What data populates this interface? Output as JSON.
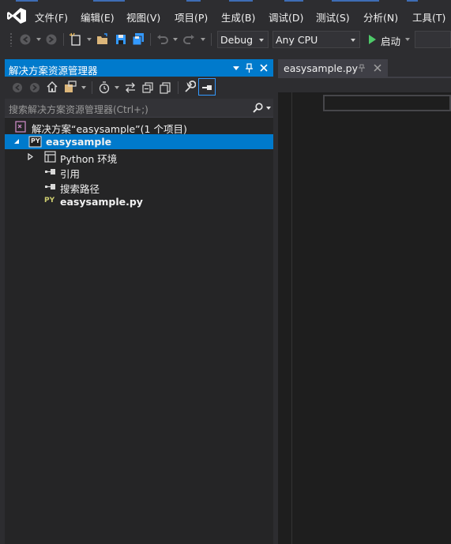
{
  "menu": {
    "items": [
      {
        "label": "文件(F)"
      },
      {
        "label": "编辑(E)"
      },
      {
        "label": "视图(V)"
      },
      {
        "label": "项目(P)"
      },
      {
        "label": "生成(B)"
      },
      {
        "label": "调试(D)"
      },
      {
        "label": "测试(S)"
      },
      {
        "label": "分析(N)"
      },
      {
        "label": "工具(T)"
      }
    ]
  },
  "toolbar": {
    "config": "Debug",
    "platform": "Any CPU",
    "start_label": "启动",
    "icons": [
      "back-icon",
      "forward-icon",
      "new-project-icon",
      "open-file-icon",
      "save-icon",
      "save-all-icon",
      "undo-icon",
      "redo-icon",
      "start-icon"
    ]
  },
  "solution_explorer": {
    "title": "解决方案资源管理器",
    "search_placeholder": "搜索解决方案资源管理器(Ctrl+;)",
    "tree": {
      "solution": "解决方案“easysample”(1 个项目)",
      "project": "easysample",
      "env": "Python 环境",
      "references": "引用",
      "search_paths": "搜索路径",
      "file": "easysample.py"
    },
    "icon_badge": "PY"
  },
  "editor": {
    "tab_label": "easysample.py"
  },
  "colors": {
    "accent": "#007acc",
    "background": "#2d2d30",
    "panel": "#252526",
    "editor": "#1e1e1e",
    "python": "#cccc6f",
    "solution": "#c586c0"
  }
}
